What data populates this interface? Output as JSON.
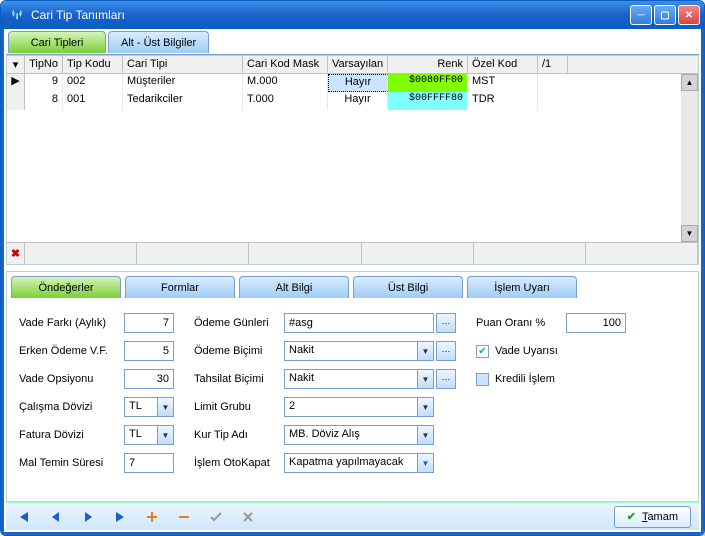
{
  "window": {
    "title": "Cari Tip Tanımları"
  },
  "topTabs": {
    "cariTipleri": "Cari Tipleri",
    "altUst": "Alt - Üst Bilgiler"
  },
  "grid": {
    "headers": {
      "tipNo": "TipNo",
      "tipKodu": "Tip Kodu",
      "cariTipi": "Cari Tipi",
      "mask": "Cari Kod Mask",
      "varsayilan": "Varsayılan",
      "renk": "Renk",
      "ozelKod": "Özel Kod",
      "sort": "/1"
    },
    "rows": [
      {
        "tipNo": "9",
        "tipKodu": "002",
        "cariTipi": "Müşteriler",
        "mask": "M.000",
        "varsayilan": "Hayır",
        "renk": "$0080FF00",
        "renkBg": "#7fff00",
        "ozelKod": "MST",
        "active": true
      },
      {
        "tipNo": "8",
        "tipKodu": "001",
        "cariTipi": "Tedarikciler",
        "mask": "T.000",
        "varsayilan": "Hayır",
        "renk": "$00FFFF80",
        "renkBg": "#80ffff",
        "ozelKod": "TDR",
        "active": false
      }
    ]
  },
  "bottomTabs": {
    "ondegerler": "Öndeğerler",
    "formlar": "Formlar",
    "altBilgi": "Alt Bilgi",
    "ustBilgi": "Üst Bilgi",
    "islemUyari": "İşlem Uyarı"
  },
  "form": {
    "col1": {
      "vadeFarki": {
        "label": "Vade Farkı (Aylık)",
        "value": "7"
      },
      "erkenOdeme": {
        "label": "Erken Ödeme V.F.",
        "value": "5"
      },
      "vadeOpsiyonu": {
        "label": "Vade Opsiyonu",
        "value": "30"
      },
      "calismaDovizi": {
        "label": "Çalışma Dövizi",
        "value": "TL"
      },
      "faturaDovizi": {
        "label": "Fatura Dövizi",
        "value": "TL"
      },
      "malTemin": {
        "label": "Mal Temin Süresi",
        "value": "7"
      }
    },
    "col2": {
      "odemeGunleri": {
        "label": "Ödeme Günleri",
        "value": "#asg"
      },
      "odemeBicimi": {
        "label": "Ödeme Biçimi",
        "value": "Nakit"
      },
      "tahsilatBicimi": {
        "label": "Tahsilat Biçimi",
        "value": "Nakit"
      },
      "limitGrubu": {
        "label": "Limit Grubu",
        "value": "2"
      },
      "kurTipAdi": {
        "label": "Kur Tip Adı",
        "value": "MB. Döviz Alış"
      },
      "islemOtoKapat": {
        "label": "İşlem OtoKapat",
        "value": "Kapatma yapılmayacak"
      }
    },
    "col3": {
      "puanOrani": {
        "label": "Puan Oranı %",
        "value": "100"
      },
      "vadeUyarisi": {
        "label": "Vade Uyarısı",
        "checked": true
      },
      "krediliIslem": {
        "label": "Kredili İşlem",
        "checked": false
      }
    }
  },
  "buttons": {
    "tamam": "Tamam"
  }
}
